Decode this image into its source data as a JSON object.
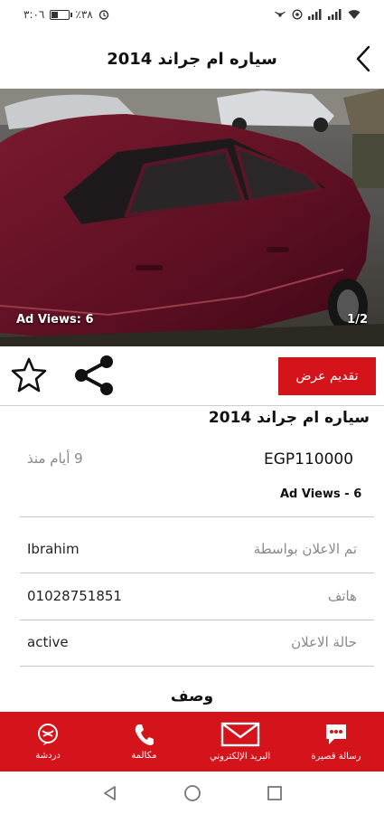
{
  "status_bar": {
    "time": "٣:٠٦",
    "battery": "٪٣٨",
    "battery_level": 0.38
  },
  "header": {
    "title": "سياره ام جراند 2014",
    "back_icon": "chevron-left-icon"
  },
  "photo": {
    "views": "Ad Views: 6",
    "counter": "1/2"
  },
  "actions": {
    "favorite_icon": "star-outline-icon",
    "share_icon": "share-icon",
    "offer_label": "تقديم عرض"
  },
  "ad": {
    "title": "سياره ام جراند 2014",
    "price": "EGP110000",
    "posted": "9 أيام منذ",
    "views": "Ad Views - 6"
  },
  "info": [
    {
      "label": "تم الاعلان بواسطة",
      "value": "Ibrahim"
    },
    {
      "label": "هاتف",
      "value": "01028751851"
    },
    {
      "label": "حالة الاعلان",
      "value": "active"
    }
  ],
  "description_title": "وصف",
  "bottom_nav": [
    {
      "label": "دردشة",
      "icon": "chat-bubble-icon"
    },
    {
      "label": "مكالمة",
      "icon": "phone-icon"
    },
    {
      "label": "البريد الإلكتروني",
      "icon": "envelope-icon"
    },
    {
      "label": "رسالة قصيرة",
      "icon": "sms-icon"
    }
  ],
  "colors": {
    "accent": "#d4131b",
    "label_gray": "#888888",
    "divider": "#c8c8c8"
  }
}
